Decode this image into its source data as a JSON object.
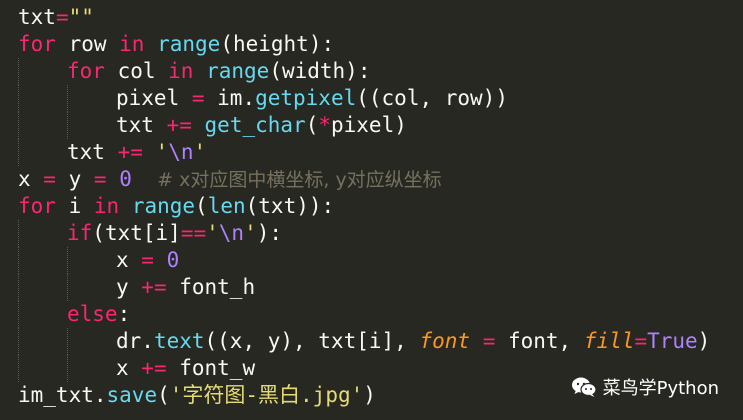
{
  "code": {
    "lines": [
      {
        "indent": 0,
        "tokens": [
          [
            "txt",
            ""
          ],
          [
            "=",
            "op"
          ],
          [
            "\"\"",
            "str"
          ]
        ]
      },
      {
        "indent": 0,
        "tokens": [
          [
            "for",
            "kw"
          ],
          [
            " row ",
            ""
          ],
          [
            "in",
            "kw"
          ],
          [
            " ",
            ""
          ],
          [
            "range",
            "builtin"
          ],
          [
            "(height):",
            ""
          ]
        ]
      },
      {
        "indent": 1,
        "tokens": [
          [
            "for",
            "kw"
          ],
          [
            " col ",
            ""
          ],
          [
            "in",
            "kw"
          ],
          [
            " ",
            ""
          ],
          [
            "range",
            "builtin"
          ],
          [
            "(width):",
            ""
          ]
        ]
      },
      {
        "indent": 2,
        "tokens": [
          [
            "pixel ",
            ""
          ],
          [
            "=",
            "op"
          ],
          [
            " im.",
            ""
          ],
          [
            "getpixel",
            "builtin"
          ],
          [
            "((col, row))",
            ""
          ]
        ]
      },
      {
        "indent": 2,
        "tokens": [
          [
            "txt ",
            ""
          ],
          [
            "+=",
            "op"
          ],
          [
            " ",
            ""
          ],
          [
            "get_char",
            "builtin"
          ],
          [
            "(",
            ""
          ],
          [
            "*",
            "op"
          ],
          [
            "pixel)",
            ""
          ]
        ]
      },
      {
        "indent": 1,
        "tokens": [
          [
            "txt ",
            ""
          ],
          [
            "+=",
            "op"
          ],
          [
            " ",
            ""
          ],
          [
            "'",
            "str"
          ],
          [
            "\\n",
            "esc"
          ],
          [
            "'",
            "str"
          ]
        ]
      },
      {
        "indent": 0,
        "tokens": [
          [
            "x ",
            ""
          ],
          [
            "=",
            "op"
          ],
          [
            " y ",
            ""
          ],
          [
            "=",
            "op"
          ],
          [
            " ",
            ""
          ],
          [
            "0",
            "num"
          ],
          [
            "  ",
            ""
          ],
          [
            "# x对应图中横坐标, y对应纵坐标",
            "comment"
          ]
        ]
      },
      {
        "indent": 0,
        "tokens": [
          [
            "for",
            "kw"
          ],
          [
            " i ",
            ""
          ],
          [
            "in",
            "kw"
          ],
          [
            " ",
            ""
          ],
          [
            "range",
            "builtin"
          ],
          [
            "(",
            ""
          ],
          [
            "len",
            "builtin"
          ],
          [
            "(txt)):",
            ""
          ]
        ]
      },
      {
        "indent": 1,
        "tokens": [
          [
            "if",
            "kw"
          ],
          [
            "(txt[i]",
            ""
          ],
          [
            "==",
            "op"
          ],
          [
            "'",
            "str"
          ],
          [
            "\\n",
            "esc"
          ],
          [
            "'",
            "str"
          ],
          [
            "):",
            ""
          ]
        ]
      },
      {
        "indent": 2,
        "tokens": [
          [
            "x ",
            ""
          ],
          [
            "=",
            "op"
          ],
          [
            " ",
            ""
          ],
          [
            "0",
            "num"
          ]
        ]
      },
      {
        "indent": 2,
        "tokens": [
          [
            "y ",
            ""
          ],
          [
            "+=",
            "op"
          ],
          [
            " font_h",
            ""
          ]
        ]
      },
      {
        "indent": 1,
        "tokens": [
          [
            "else",
            "kw"
          ],
          [
            ":",
            ""
          ]
        ]
      },
      {
        "indent": 2,
        "tokens": [
          [
            "dr.",
            ""
          ],
          [
            "text",
            "builtin"
          ],
          [
            "((x, y), txt[i], ",
            ""
          ],
          [
            "font",
            "kwarg"
          ],
          [
            " ",
            ""
          ],
          [
            "=",
            "op"
          ],
          [
            " font, ",
            ""
          ],
          [
            "fill",
            "kwarg"
          ],
          [
            "=",
            "op"
          ],
          [
            "True",
            "const"
          ],
          [
            ")",
            ""
          ]
        ]
      },
      {
        "indent": 2,
        "tokens": [
          [
            "x ",
            ""
          ],
          [
            "+=",
            "op"
          ],
          [
            " font_w",
            ""
          ]
        ]
      },
      {
        "indent": 0,
        "tokens": [
          [
            "im_txt.",
            ""
          ],
          [
            "save",
            "builtin"
          ],
          [
            "(",
            ""
          ],
          [
            "'字符图-黑白.jpg'",
            "str"
          ],
          [
            ")",
            ""
          ]
        ]
      }
    ]
  },
  "watermark": {
    "icon": "wechat-icon",
    "label": "菜鸟学Python"
  },
  "colors": {
    "background": "#272822",
    "keyword": "#f92672",
    "builtin": "#66d9ef",
    "number": "#ae81ff",
    "string": "#e6db74",
    "comment": "#75715e",
    "kwarg": "#fd971f"
  }
}
